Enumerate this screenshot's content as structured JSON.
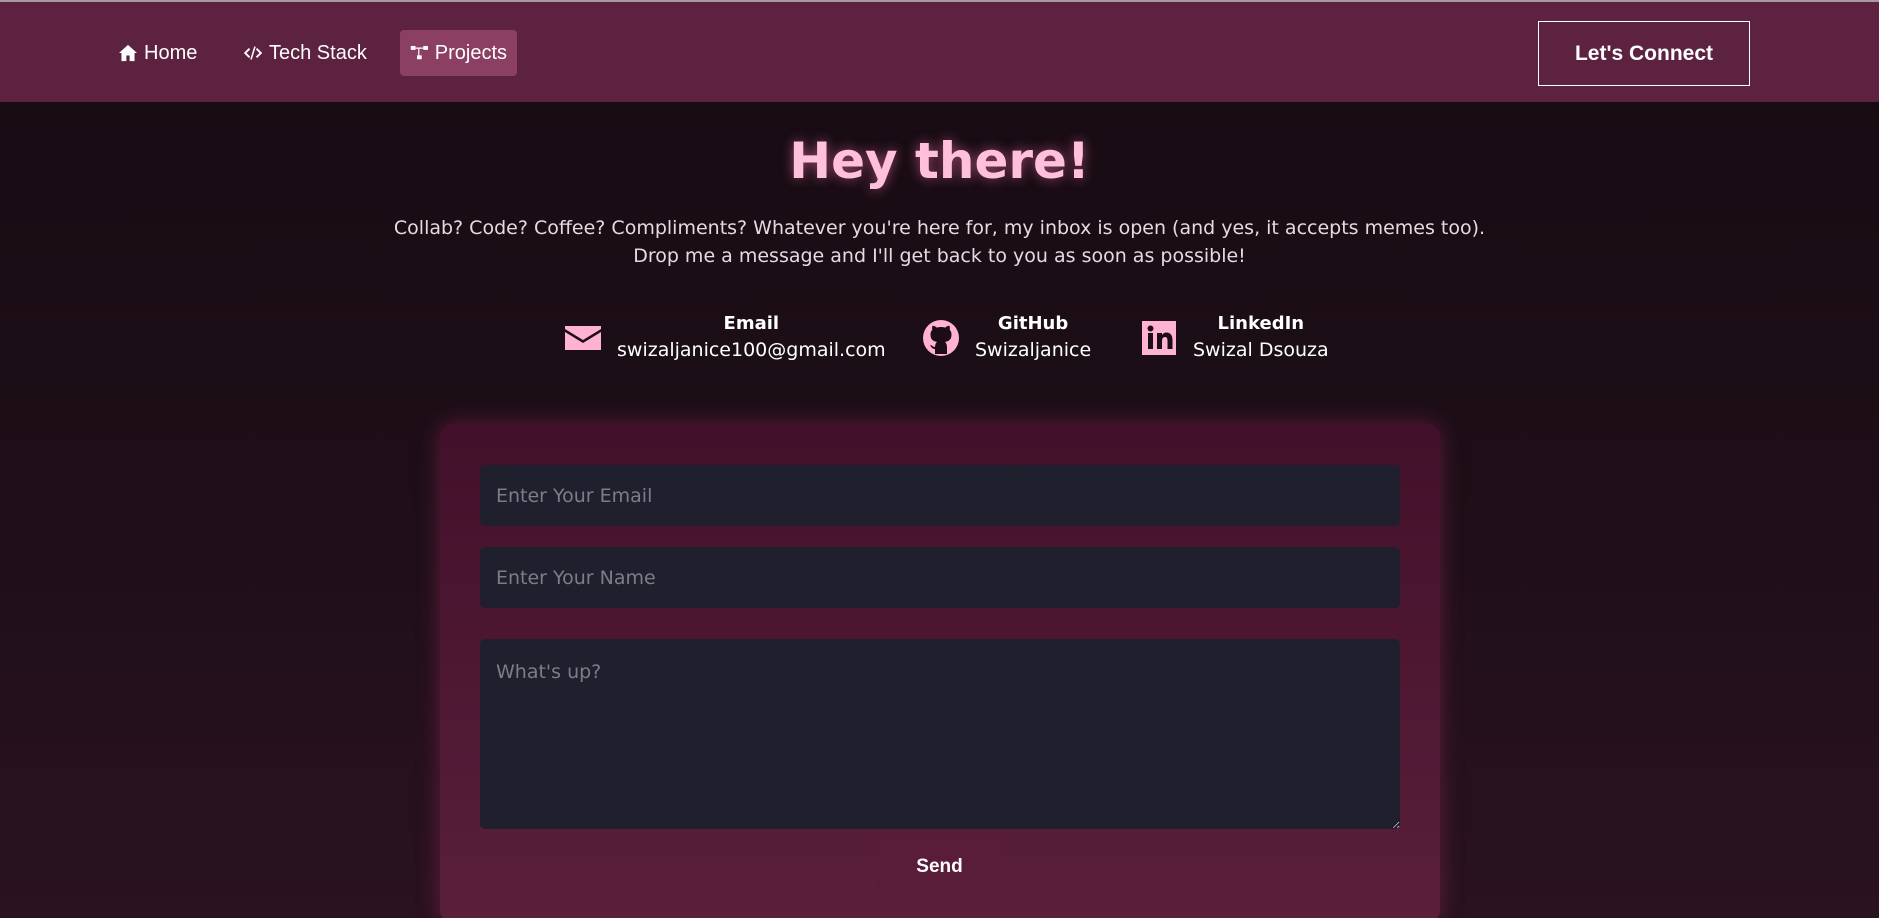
{
  "nav": {
    "items": [
      {
        "label": "Home",
        "icon": "home-icon"
      },
      {
        "label": "Tech Stack",
        "icon": "code-icon"
      },
      {
        "label": "Projects",
        "icon": "sitemap-icon",
        "active": true
      }
    ],
    "connect_label": "Let's Connect"
  },
  "hero": {
    "title": "Hey there!",
    "line1": "Collab? Code? Coffee? Compliments? Whatever you're here for, my inbox is open (and yes, it accepts memes too).",
    "line2": "Drop me a message and I'll get back to you as soon as possible!"
  },
  "contacts": {
    "email": {
      "label": "Email",
      "value": "swizaljanice100@gmail.com",
      "icon": "envelope-icon"
    },
    "github": {
      "label": "GitHub",
      "value": "Swizaljanice",
      "icon": "github-icon"
    },
    "linkedin": {
      "label": "LinkedIn",
      "value": "Swizal Dsouza",
      "icon": "linkedin-icon"
    }
  },
  "form": {
    "email_placeholder": "Enter Your Email",
    "name_placeholder": "Enter Your Name",
    "message_placeholder": "What's up?",
    "send_label": "Send"
  },
  "colors": {
    "navbar": "#5c2240",
    "accent": "#ffc0dc",
    "input_bg": "#1f1f2e"
  }
}
